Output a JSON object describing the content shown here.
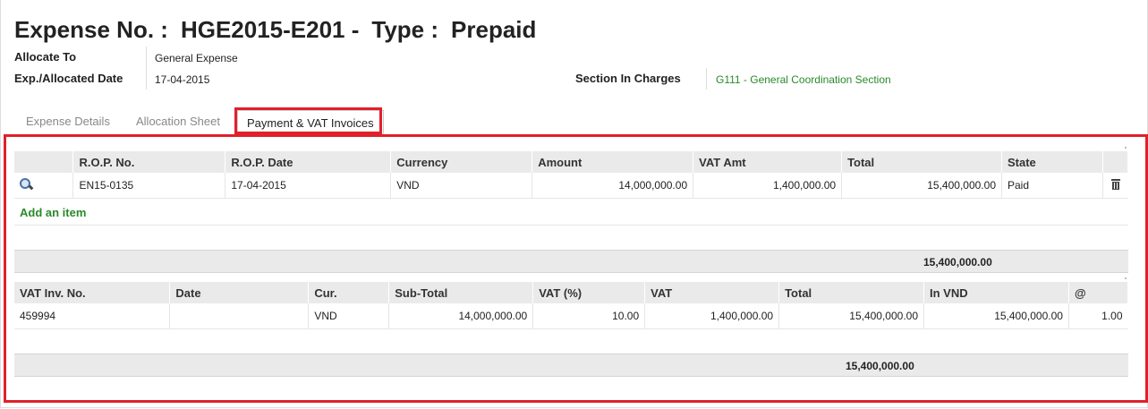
{
  "header": {
    "expense_label": "Expense No. :",
    "expense_no": "HGE2015-E201 -",
    "type_label": "Type :",
    "type_value": "Prepaid"
  },
  "fields": {
    "allocate_to_label": "Allocate To",
    "allocate_to_value": "General Expense",
    "date_label": "Exp./Allocated Date",
    "date_value": "17-04-2015",
    "section_label": "Section In Charges",
    "section_value": "G111 - General Coordination Section"
  },
  "tabs": [
    "Expense Details",
    "Allocation Sheet",
    "Payment & VAT Invoices"
  ],
  "rop_table": {
    "headers": [
      "R.O.P. No.",
      "R.O.P. Date",
      "Currency",
      "Amount",
      "VAT Amt",
      "Total",
      "State"
    ],
    "rows": [
      {
        "rop_no": "EN15-0135",
        "rop_date": "17-04-2015",
        "currency": "VND",
        "amount": "14,000,000.00",
        "vat_amt": "1,400,000.00",
        "total": "15,400,000.00",
        "state": "Paid"
      }
    ],
    "add_item": "Add an item",
    "grand_total": "15,400,000.00"
  },
  "vat_table": {
    "headers": [
      "VAT Inv. No.",
      "Date",
      "Cur.",
      "Sub-Total",
      "VAT (%)",
      "VAT",
      "Total",
      "In VND",
      "@"
    ],
    "rows": [
      {
        "inv_no": "459994",
        "date": "",
        "cur": "VND",
        "subtotal": "14,000,000.00",
        "vat_pct": "10.00",
        "vat": "1,400,000.00",
        "total": "15,400,000.00",
        "in_vnd": "15,400,000.00",
        "rate": "1.00"
      }
    ],
    "grand_total": "15,400,000.00"
  },
  "icons": {
    "view": "magnifier-icon",
    "delete": "trash-icon"
  },
  "colors": {
    "highlight": "#e0202a",
    "link_green": "#2a8a2a",
    "header_bg": "#eaeaea"
  }
}
